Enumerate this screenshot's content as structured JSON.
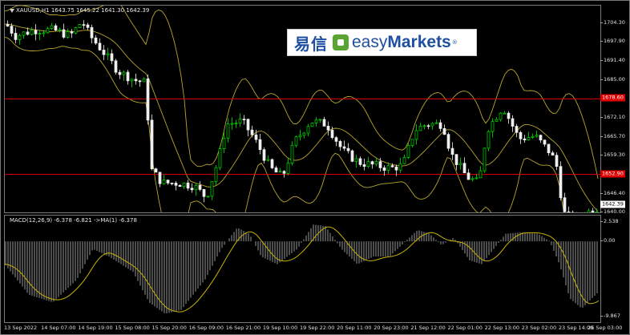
{
  "chart": {
    "symbol_info": "XAUUSD,H1  1643.75 1645.22 1641.30 1642.39",
    "macd_info": "MACD(12,26,9) -6.378 -6.821  ->MA(1) -6.378",
    "price_axis_ticks": [
      "1704.30",
      "1697.90",
      "1691.40",
      "1685.00",
      "1678.60",
      "1672.10",
      "1665.70",
      "1659.30",
      "1652.90",
      "1646.40",
      "1640.00"
    ],
    "price_tags": {
      "upper_line": "1678.60",
      "lower_line": "1652.90",
      "current_price": "1642.39"
    },
    "macd_axis_ticks": [
      "2.538",
      "0.00",
      "-9.867"
    ],
    "time_labels": [
      "13 Sep 2022",
      "14 Sep 07:00",
      "14 Sep 19:00",
      "15 Sep 08:00",
      "15 Sep 20:00",
      "16 Sep 09:00",
      "16 Sep 21:00",
      "19 Sep 10:00",
      "19 Sep 22:00",
      "20 Sep 11:00",
      "20 Sep 23:00",
      "21 Sep 12:00",
      "22 Sep 01:00",
      "22 Sep 13:00",
      "23 Sep 02:00",
      "23 Sep 14:00",
      "26 Sep 03:00"
    ],
    "colors": {
      "background": "#000000",
      "candle_bull": "#00e000",
      "candle_bear": "#f0f0f0",
      "bollinger": "#b8a52a",
      "level_line": "#e00000",
      "macd_hist": "#d8d8d8",
      "macd_signal": "#c8b400",
      "current_tag_bg": "#ffffff"
    }
  },
  "logo": {
    "chinese": "易信",
    "english_a": "easy",
    "english_b": "Markets",
    "registered": "®"
  }
}
